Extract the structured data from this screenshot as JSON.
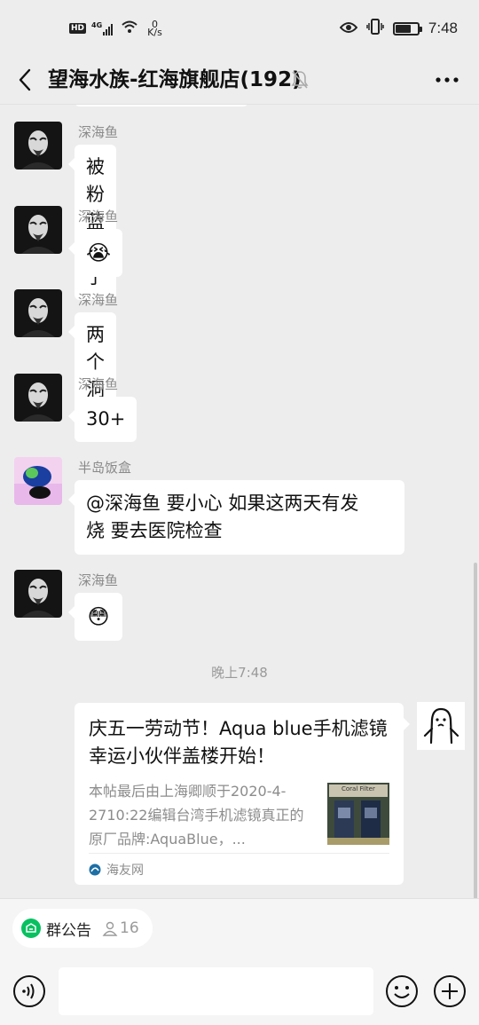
{
  "status_bar": {
    "hd": "HD",
    "network_type": "4G",
    "speed_value": "0",
    "speed_unit": "K/s",
    "time": "7:48",
    "battery_level": 0.72
  },
  "header": {
    "title": "望海水族-红海旗舰店(192)",
    "icons": [
      "back-arrow-icon",
      "bell-muted-icon",
      "more-icon"
    ]
  },
  "messages": [
    {
      "sender": "深海鱼",
      "text": "被粉蓝打了"
    },
    {
      "sender": "深海鱼",
      "emoji": "😭"
    },
    {
      "sender": "深海鱼",
      "text": "两个洞"
    },
    {
      "sender": "深海鱼",
      "text": "30+"
    },
    {
      "sender": "半岛饭盒",
      "line1": "@深海鱼  要小心 如果这两天有发",
      "line2": "烧 要去医院检查"
    },
    {
      "sender": "深海鱼",
      "emoji": "😳"
    }
  ],
  "time_divider": "晚上7:48",
  "link_card": {
    "title": "庆五一劳动节！Aqua blue手机滤镜幸运小伙伴盖楼开始！",
    "description": "本帖最后由上海卿顺于2020-4-2710:22编辑台湾手机滤镜真正的原厂品牌:AquaBlue，...",
    "thumb_text": "Coral Filter",
    "source": "海友网"
  },
  "notice": {
    "label": "群公告",
    "count": "16"
  },
  "colors": {
    "background": "#ededed",
    "bubble": "#ffffff",
    "notice_icon": "#07c160"
  }
}
